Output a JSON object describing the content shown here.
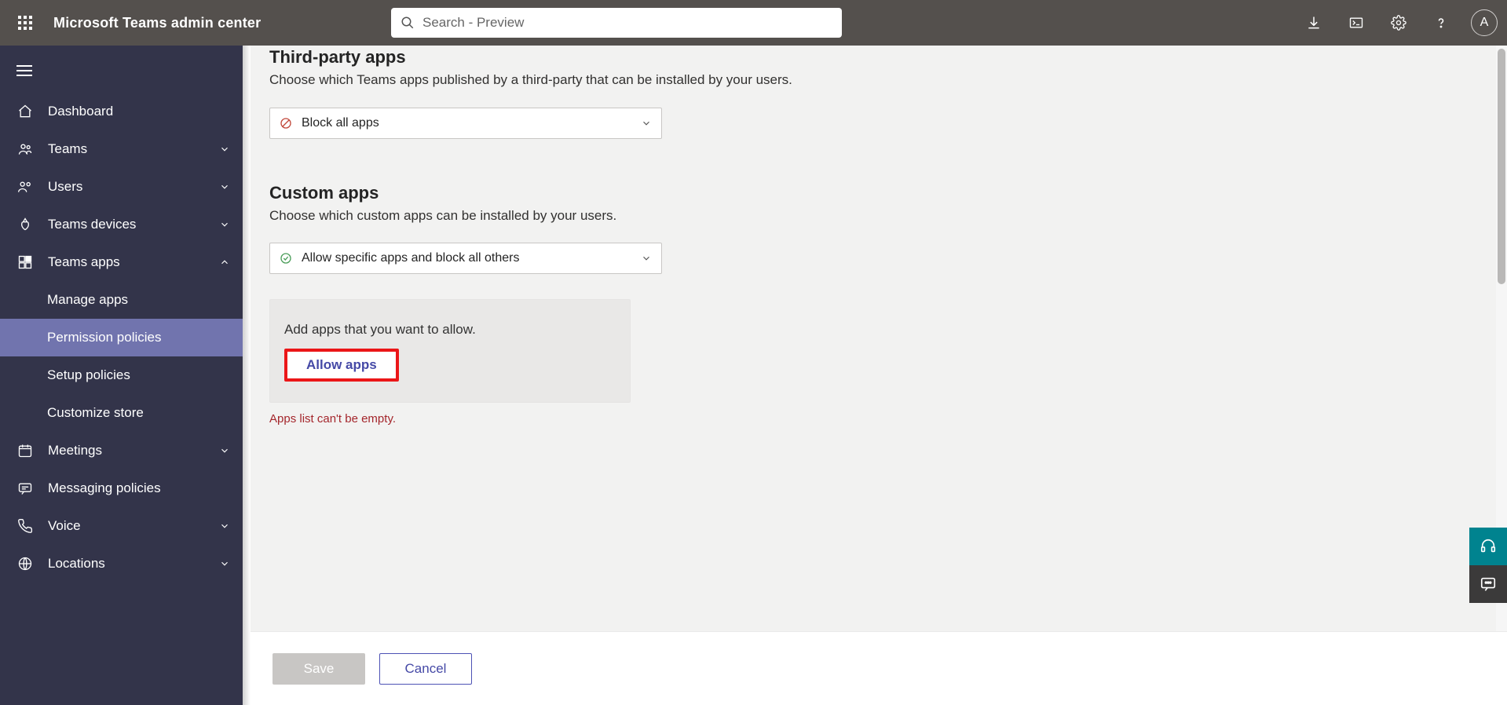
{
  "header": {
    "app_title": "Microsoft Teams admin center",
    "search_placeholder": "Search - Preview",
    "avatar_initial": "A"
  },
  "sidebar": {
    "items": [
      {
        "label": "Dashboard"
      },
      {
        "label": "Teams"
      },
      {
        "label": "Users"
      },
      {
        "label": "Teams devices"
      },
      {
        "label": "Teams apps",
        "expanded": true,
        "children": [
          {
            "label": "Manage apps"
          },
          {
            "label": "Permission policies",
            "active": true
          },
          {
            "label": "Setup policies"
          },
          {
            "label": "Customize store"
          }
        ]
      },
      {
        "label": "Meetings"
      },
      {
        "label": "Messaging policies"
      },
      {
        "label": "Voice"
      },
      {
        "label": "Locations"
      }
    ]
  },
  "main": {
    "third_party": {
      "title": "Third-party apps",
      "desc": "Choose which Teams apps published by a third-party that can be installed by your users.",
      "selected": "Block all apps"
    },
    "custom": {
      "title": "Custom apps",
      "desc": "Choose which custom apps can be installed by your users.",
      "selected": "Allow specific apps and block all others",
      "allow_prompt": "Add apps that you want to allow.",
      "allow_button": "Allow apps",
      "error": "Apps list can't be empty."
    },
    "footer": {
      "save": "Save",
      "cancel": "Cancel"
    }
  }
}
